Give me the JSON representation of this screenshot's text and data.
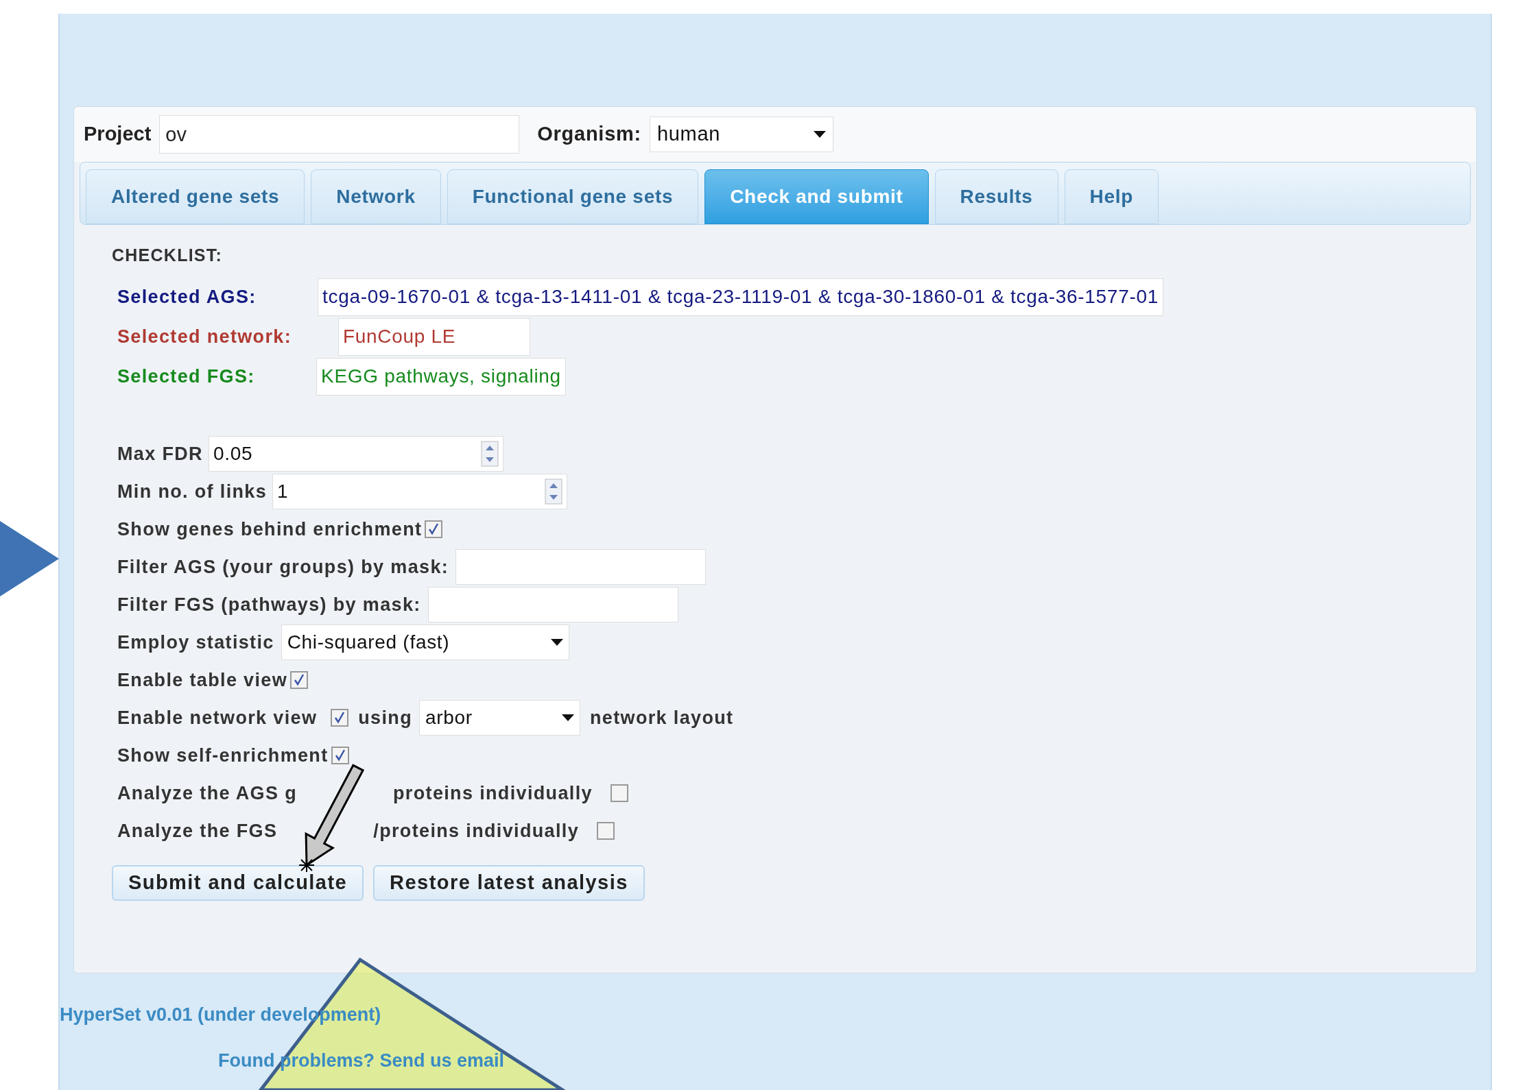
{
  "header": {
    "project_label": "Project",
    "project_value": "ov",
    "organism_label": "Organism:",
    "organism_value": "human"
  },
  "tabs": [
    {
      "label": "Altered gene sets",
      "selected": false
    },
    {
      "label": "Network",
      "selected": false
    },
    {
      "label": "Functional gene sets",
      "selected": false
    },
    {
      "label": "Check and submit",
      "selected": true
    },
    {
      "label": "Results",
      "selected": false
    },
    {
      "label": "Help",
      "selected": false
    }
  ],
  "checklist": {
    "title": "CHECKLIST:",
    "items": [
      {
        "label": "Selected AGS:",
        "value": "tcga-09-1670-01 & tcga-13-1411-01 & tcga-23-1119-01 & tcga-30-1860-01 & tcga-36-1577-01",
        "color": "#141a80"
      },
      {
        "label": "Selected network:",
        "value": "FunCoup LE",
        "color": "#b03a32"
      },
      {
        "label": "Selected FGS:",
        "value": "KEGG pathways, signaling",
        "color": "#168a1e"
      }
    ]
  },
  "options": [
    {
      "kind": "spinner",
      "label": "Max FDR",
      "value": "0.05"
    },
    {
      "kind": "spinner",
      "label": "Min no. of links",
      "value": "1"
    },
    {
      "kind": "checkbox",
      "label": "Show genes behind enrichment",
      "checked": true
    },
    {
      "kind": "text",
      "label": "Filter AGS (your groups) by mask:"
    },
    {
      "kind": "text",
      "label": "Filter FGS (pathways) by mask:"
    },
    {
      "kind": "select",
      "label": "Employ statistic",
      "value": "Chi-squared (fast)"
    },
    {
      "kind": "checkbox",
      "label": "Enable table view",
      "checked": true
    },
    {
      "kind": "network",
      "label": "Enable network view",
      "checked": true,
      "using": "using",
      "value": "arbor",
      "suffix": "network layout"
    },
    {
      "kind": "checkbox",
      "label": "Show self-enrichment",
      "checked": true
    },
    {
      "kind": "checkbox",
      "label_parts": [
        "Analyze the AGS g",
        "proteins individually"
      ],
      "checked": false
    },
    {
      "kind": "checkbox",
      "label_parts": [
        "Analyze the FGS",
        "/proteins individually"
      ],
      "checked": false
    }
  ],
  "buttons": [
    "Submit and calculate",
    "Restore latest analysis"
  ],
  "footer": {
    "version": "HyperSet v0.01 (under development)",
    "contact": "Found problems? Send us email"
  }
}
